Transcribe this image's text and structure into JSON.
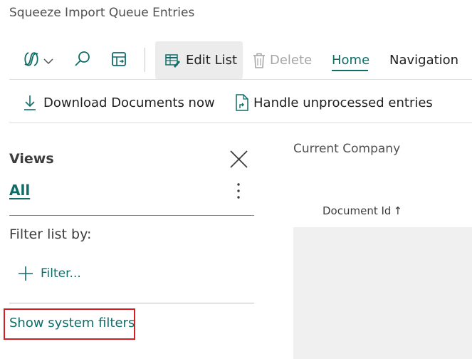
{
  "page": {
    "title": "Squeeze Import Queue Entries"
  },
  "toolbar": {
    "edit_list_label": "Edit List",
    "delete_label": "Delete",
    "tabs": [
      {
        "label": "Home",
        "active": true
      },
      {
        "label": "Navigation",
        "active": false
      }
    ]
  },
  "actions": [
    {
      "label": "Download Documents now",
      "icon": "download-icon"
    },
    {
      "label": "Handle unprocessed entries",
      "icon": "document-arrow-icon"
    }
  ],
  "views": {
    "title": "Views",
    "selected_view": "All",
    "filter_heading": "Filter list by:",
    "add_filter_label": "Filter...",
    "show_system_filters_label": "Show system filters"
  },
  "list": {
    "company_label": "Current Company",
    "columns": [
      {
        "label": "Document Id",
        "sort": "ascending",
        "sort_glyph": "↑"
      }
    ]
  },
  "colors": {
    "accent": "#0f6d68",
    "highlight_box": "#d21f25",
    "active_button_bg": "#ececec",
    "grid_bg": "#f0f0f0"
  }
}
